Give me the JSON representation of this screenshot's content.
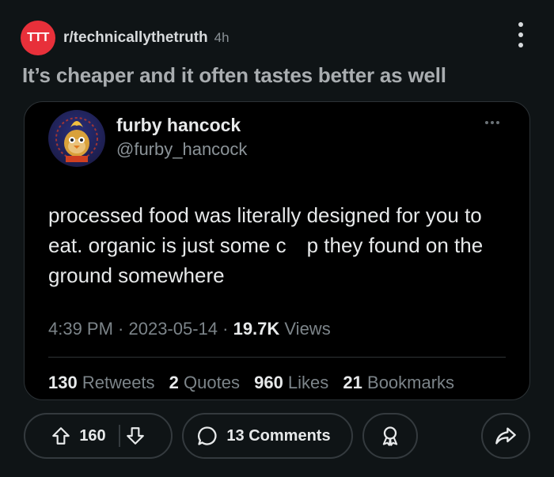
{
  "post": {
    "sub_icon_text": "TTT",
    "subreddit": "r/technicallythetruth",
    "time": "4h",
    "title": "It’s cheaper and it often tastes better as well",
    "sub_icon_color": "#e8303a"
  },
  "tweet": {
    "name": "furby hancock",
    "handle": "@furby_hancock",
    "text": "processed food was literally designed for you to eat. organic is just some c  p they found on the ground somewhere",
    "time": "4:39 PM · 2023-05-14 · ",
    "views_count": "19.7K",
    "views_label": " Views",
    "stats": [
      {
        "count": "130",
        "label": " Retweets"
      },
      {
        "count": "2",
        "label": " Quotes"
      },
      {
        "count": "960",
        "label": " Likes"
      },
      {
        "count": "21",
        "label": " Bookmarks"
      }
    ]
  },
  "actions": {
    "vote_count": "160",
    "comments_label": "13 Comments"
  },
  "icons": [
    "kebab-menu-icon",
    "ellipsis-icon",
    "upvote-icon",
    "downvote-icon",
    "comment-bubble-icon",
    "award-icon",
    "share-arrow-icon"
  ]
}
